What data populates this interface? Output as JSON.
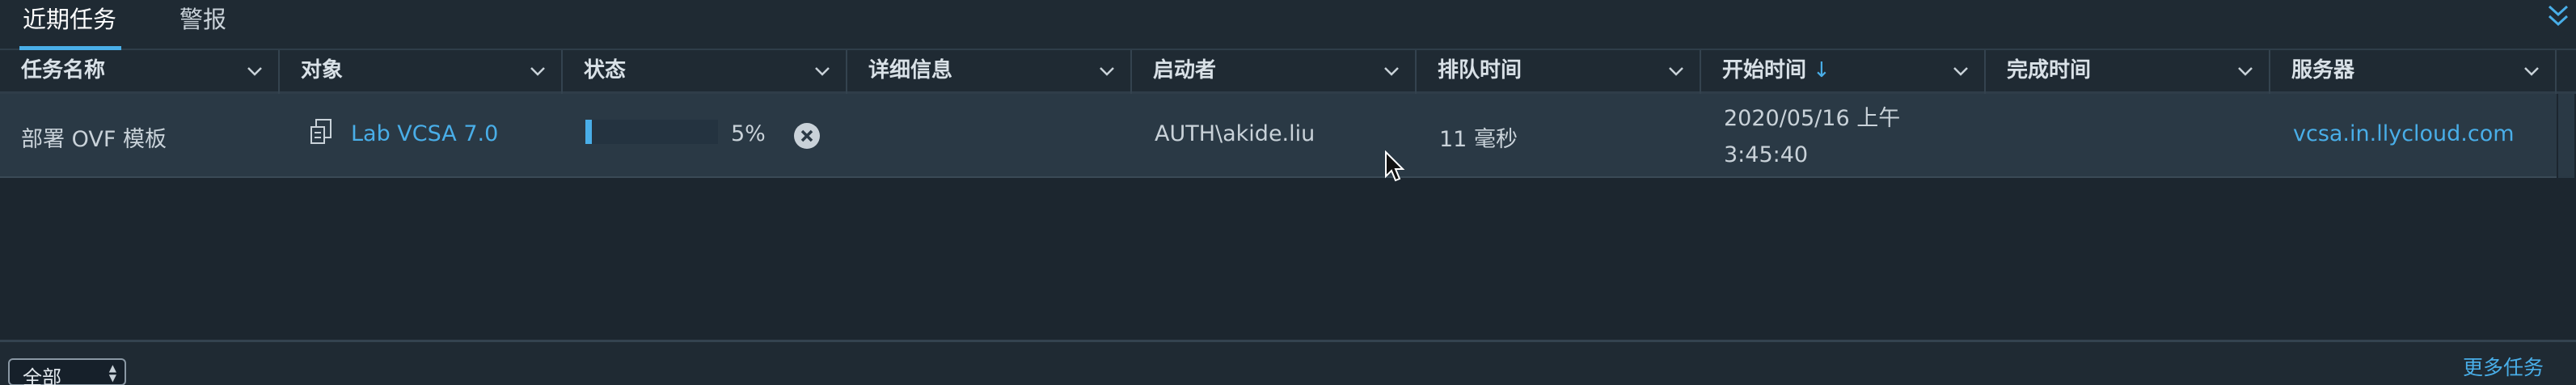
{
  "tabs": [
    {
      "label": "近期任务",
      "active": true
    },
    {
      "label": "警报",
      "active": false
    }
  ],
  "columns": [
    {
      "label": "任务名称"
    },
    {
      "label": "对象"
    },
    {
      "label": "状态"
    },
    {
      "label": "详细信息"
    },
    {
      "label": "启动者"
    },
    {
      "label": "排队时间"
    },
    {
      "label": "开始时间",
      "sort": "↓"
    },
    {
      "label": "完成时间"
    },
    {
      "label": "服务器"
    }
  ],
  "rows": [
    {
      "task_name": "部署 OVF 模板",
      "object": "Lab VCSA 7.0",
      "object_icon": "vm-template-icon",
      "progress_percent": 5,
      "progress_label": "5%",
      "details": "",
      "initiator": "AUTH\\akide.liu",
      "queued_time": "11 毫秒",
      "start_time_date": "2020/05/16 上午",
      "start_time_clock": "3:45:40",
      "completion_time": "",
      "server": "vcsa.in.llycloud.com"
    }
  ],
  "footer": {
    "filter_value": "全部",
    "more_tasks": "更多任务"
  },
  "colors": {
    "accent": "#49aee8",
    "background": "#1c262f",
    "row_selected": "#2a3945"
  }
}
